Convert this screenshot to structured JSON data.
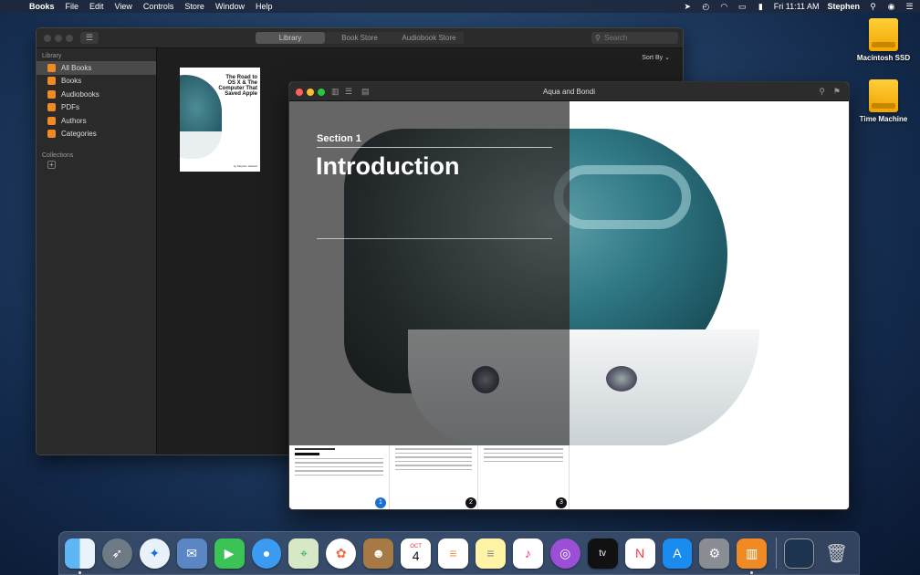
{
  "menubar": {
    "app_name": "Books",
    "menus": [
      "File",
      "Edit",
      "View",
      "Controls",
      "Store",
      "Window",
      "Help"
    ],
    "clock": "Fri 11:11 AM",
    "user": "Stephen"
  },
  "desktop": {
    "drives": [
      "Macintosh SSD",
      "Time Machine"
    ]
  },
  "library": {
    "tabs": [
      "Library",
      "Book Store",
      "Audiobook Store"
    ],
    "selected_tab": "Library",
    "search_placeholder": "Search",
    "sidebar_heading": "Library",
    "sidebar_items": [
      {
        "label": "All Books",
        "icon": "books-icon"
      },
      {
        "label": "Books",
        "icon": "book-icon"
      },
      {
        "label": "Audiobooks",
        "icon": "headphones-icon"
      },
      {
        "label": "PDFs",
        "icon": "pdf-icon"
      },
      {
        "label": "Authors",
        "icon": "people-icon"
      },
      {
        "label": "Categories",
        "icon": "list-icon"
      }
    ],
    "collections_heading": "Collections",
    "sort_label": "Sort By",
    "book": {
      "title": "The Road to OS X & The Computer That Saved Apple",
      "author": "by Stephen Hackett"
    }
  },
  "reader": {
    "title": "Aqua and Bondi",
    "section_label": "Section 1",
    "section_title": "Introduction",
    "page_numbers": [
      "1",
      "2",
      "3"
    ],
    "accent_color": "#1a6fd1"
  },
  "dock": {
    "apps": [
      "Finder",
      "Launchpad",
      "Safari",
      "Mail",
      "FaceTime",
      "Messages",
      "Maps",
      "Photos",
      "Contacts",
      "Calendar",
      "Reminders",
      "Notes",
      "Music",
      "Podcasts",
      "TV",
      "News",
      "App Store",
      "System Preferences",
      "Books"
    ],
    "calendar_day": "4",
    "calendar_month": "OCT"
  }
}
